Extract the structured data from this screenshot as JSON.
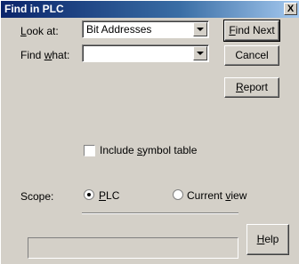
{
  "window": {
    "title": "Find in PLC",
    "close_glyph": "X"
  },
  "look_at": {
    "label_pre": "",
    "label_mn": "L",
    "label_post": "ook at:",
    "value": "Bit Addresses"
  },
  "find_what": {
    "label_pre": "Find ",
    "label_mn": "w",
    "label_post": "hat:",
    "value": ""
  },
  "buttons": {
    "find_next": {
      "pre": "",
      "mn": "F",
      "post": "ind Next"
    },
    "cancel": {
      "pre": "Cancel",
      "mn": "",
      "post": ""
    },
    "report": {
      "pre": "",
      "mn": "R",
      "post": "eport"
    },
    "help": {
      "pre": "",
      "mn": "H",
      "post": "elp"
    }
  },
  "include_symbol_table": {
    "pre": "Include ",
    "mn": "s",
    "post": "ymbol table",
    "checked": false
  },
  "scope": {
    "label": "Scope:",
    "options": [
      {
        "pre": "",
        "mn": "P",
        "post": "LC",
        "checked": true
      },
      {
        "pre": "Current ",
        "mn": "v",
        "post": "iew",
        "checked": false
      }
    ]
  },
  "status": {
    "text": ""
  }
}
